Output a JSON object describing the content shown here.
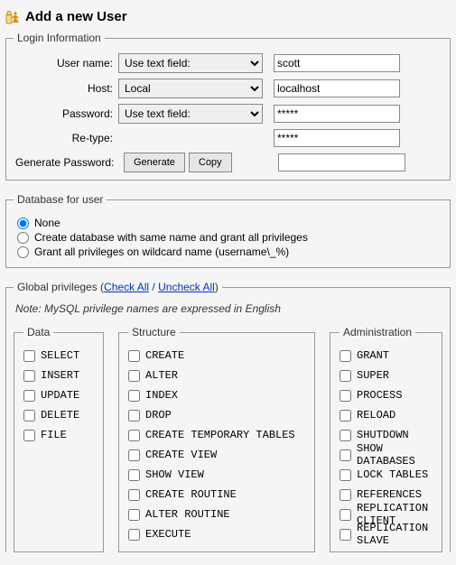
{
  "title": "Add a new User",
  "login": {
    "legend": "Login Information",
    "username_label": "User name:",
    "username_mode": "Use text field:",
    "username_value": "scott",
    "host_label": "Host:",
    "host_mode": "Local",
    "host_value": "localhost",
    "password_label": "Password:",
    "password_mode": "Use text field:",
    "password_value": "*****",
    "retype_label": "Re-type:",
    "retype_value": "*****",
    "generate_label": "Generate Password:",
    "generate_btn": "Generate",
    "copy_btn": "Copy",
    "generate_output": ""
  },
  "db": {
    "legend": "Database for user",
    "opt_none": "None",
    "opt_same": "Create database with same name and grant all privileges",
    "opt_wild": "Grant all privileges on wildcard name (username\\_%)"
  },
  "priv": {
    "legend": "Global privileges",
    "check_all": "Check All",
    "sep": " / ",
    "uncheck_all": "Uncheck All",
    "note": "Note: MySQL privilege names are expressed in English",
    "data_legend": "Data",
    "struct_legend": "Structure",
    "admin_legend": "Administration",
    "data": [
      "SELECT",
      "INSERT",
      "UPDATE",
      "DELETE",
      "FILE"
    ],
    "struct": [
      "CREATE",
      "ALTER",
      "INDEX",
      "DROP",
      "CREATE TEMPORARY TABLES",
      "CREATE VIEW",
      "SHOW VIEW",
      "CREATE ROUTINE",
      "ALTER ROUTINE",
      "EXECUTE"
    ],
    "admin": [
      "GRANT",
      "SUPER",
      "PROCESS",
      "RELOAD",
      "SHUTDOWN",
      "SHOW DATABASES",
      "LOCK TABLES",
      "REFERENCES",
      "REPLICATION CLIENT",
      "REPLICATION SLAVE"
    ]
  }
}
